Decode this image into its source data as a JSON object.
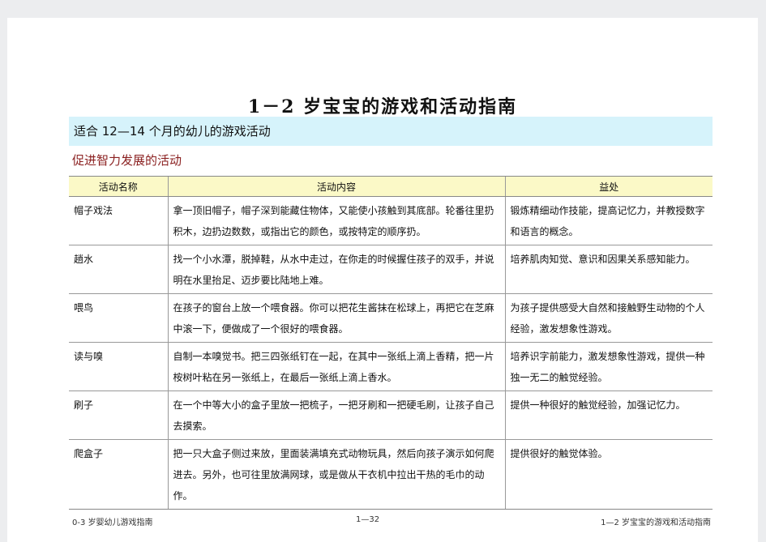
{
  "title": "1－2 岁宝宝的游戏和活动指南",
  "section_band": "适合 12—14 个月的幼儿的游戏活动",
  "subheading": "促进智力发展的活动",
  "table": {
    "headers": [
      "活动名称",
      "活动内容",
      "益处"
    ],
    "rows": [
      {
        "name": "帽子戏法",
        "content": "拿一顶旧帽子，帽子深到能藏住物体，又能使小孩触到其底部。轮番往里扔积木，边扔边数数，或指出它的颜色，或按特定的顺序扔。",
        "benefit": "锻炼精细动作技能，提高记忆力，并教授数字和语言的概念。"
      },
      {
        "name": "趟水",
        "content": "找一个小水潭，脱掉鞋，从水中走过，在你走的时候握住孩子的双手，并说明在水里抬足、迈步要比陆地上难。",
        "benefit": "培养肌肉知觉、意识和因果关系感知能力。"
      },
      {
        "name": "喂鸟",
        "content": "在孩子的窗台上放一个喂食器。你可以把花生酱抹在松球上，再把它在芝麻中滚一下，便做成了一个很好的喂食器。",
        "benefit": "为孩子提供感受大自然和接触野生动物的个人经验，激发想象性游戏。"
      },
      {
        "name": "读与嗅",
        "content": "自制一本嗅觉书。把三四张纸钉在一起，在其中一张纸上滴上香精，把一片桉树叶粘在另一张纸上，在最后一张纸上滴上香水。",
        "benefit": "培养识字前能力，激发想象性游戏，提供一种独一无二的触觉经验。"
      },
      {
        "name": "刷子",
        "content": "在一个中等大小的盒子里放一把梳子，一把牙刷和一把硬毛刷，让孩子自己去摸索。",
        "benefit": "提供一种很好的触觉经验，加强记忆力。"
      },
      {
        "name": "爬盒子",
        "content": "把一只大盒子侧过来放，里面装满填充式动物玩具，然后向孩子演示如何爬进去。另外，也可往里放满网球，或是做从干衣机中拉出干热的毛巾的动作。",
        "benefit": "提供很好的触觉体验。"
      }
    ]
  },
  "footer": {
    "left": "0-3 岁婴幼儿游戏指南",
    "center": "1—32",
    "right": "1—2 岁宝宝的游戏和活动指南"
  }
}
